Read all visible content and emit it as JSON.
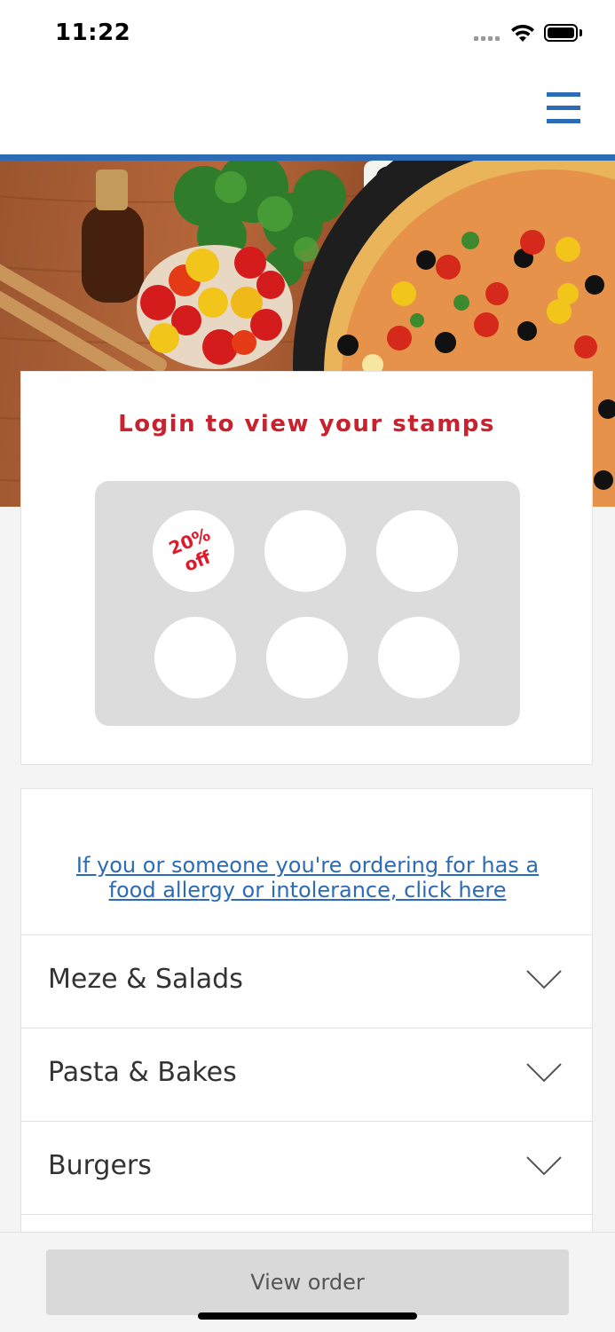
{
  "status_bar": {
    "time": "11:22"
  },
  "header": {
    "menu_icon": "hamburger-menu-icon",
    "accent_color": "#2c6bb5"
  },
  "hero": {
    "image": "pizza-with-tomatoes-herbs-olives"
  },
  "stamp_card": {
    "title": "Login to view your stamps",
    "title_color": "#c8222e",
    "stamps_total": 6,
    "reward_label_line1": "20%",
    "reward_label_line2": "off",
    "reward_color": "#e11a2a"
  },
  "allergy": {
    "link_text": "If you or someone you're ordering for has a food allergy or intolerance, click here"
  },
  "categories": [
    {
      "label": "Meze & Salads"
    },
    {
      "label": "Pasta & Bakes"
    },
    {
      "label": "Burgers"
    }
  ],
  "footer": {
    "view_order_label": "View order"
  }
}
